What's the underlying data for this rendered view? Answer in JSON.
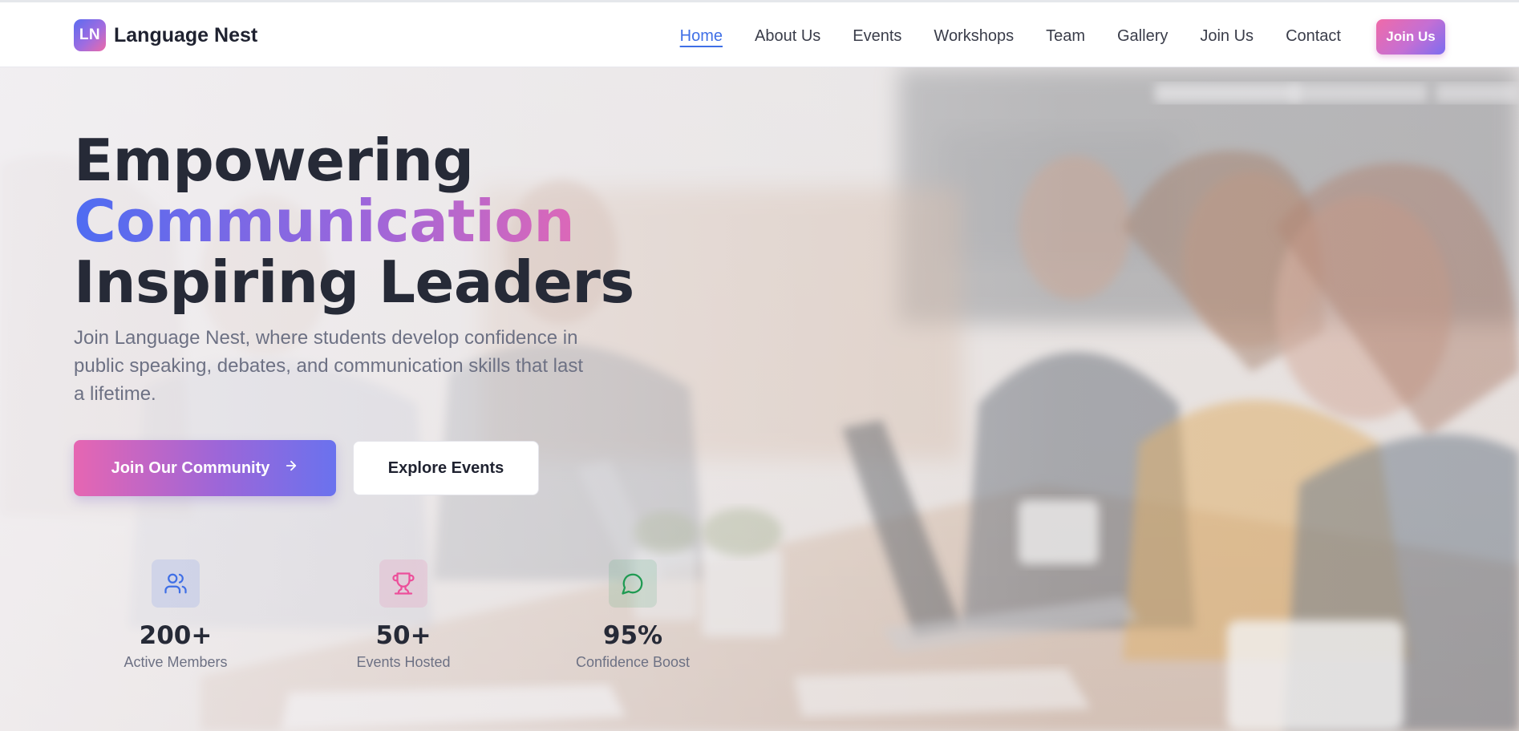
{
  "brand": {
    "logo_text": "LN",
    "name": "Language Nest"
  },
  "nav": {
    "links": [
      {
        "label": "Home",
        "active": true
      },
      {
        "label": "About Us"
      },
      {
        "label": "Events"
      },
      {
        "label": "Workshops"
      },
      {
        "label": "Team"
      },
      {
        "label": "Gallery"
      },
      {
        "label": "Join Us"
      },
      {
        "label": "Contact"
      }
    ],
    "cta_label": "Join Us"
  },
  "hero": {
    "title_line1": "Empowering",
    "title_line2": "Communication",
    "title_line3": "Inspiring Leaders",
    "subtitle": "Join Language Nest, where students develop confidence in public speaking, debates, and communication skills that last a lifetime.",
    "primary_button": "Join Our Community",
    "primary_button_icon": "arrow-right-icon",
    "secondary_button": "Explore Events"
  },
  "stats": [
    {
      "icon": "users-icon",
      "value": "200+",
      "label": "Active Members",
      "color": "#3f6fe6"
    },
    {
      "icon": "trophy-icon",
      "value": "50+",
      "label": "Events Hosted",
      "color": "#ec4f9a"
    },
    {
      "icon": "chat-bubble-icon",
      "value": "95%",
      "label": "Confidence Boost",
      "color": "#1f9a52"
    }
  ],
  "colors": {
    "accent_blue": "#3f6fe6",
    "gradient_pink": "#ee68ae",
    "gradient_purple": "#9a66dc",
    "gradient_blue": "#4e6cf2",
    "heading": "#262a37",
    "body_text": "#6d7184"
  }
}
